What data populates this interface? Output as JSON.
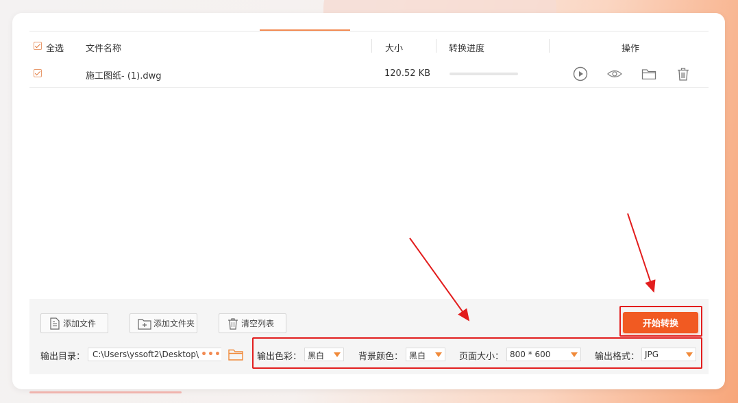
{
  "table": {
    "headers": {
      "select_all": "全选",
      "file_name": "文件名称",
      "size": "大小",
      "progress": "转换进度",
      "actions": "操作"
    },
    "rows": [
      {
        "name": "施工图纸- (1).dwg",
        "size": "120.52 KB",
        "progress": 0,
        "checked": true
      }
    ]
  },
  "toolbar": {
    "add_file": "添加文件",
    "add_folder": "添加文件夹",
    "clear_list": "清空列表",
    "start": "开始转换"
  },
  "output": {
    "dir_label": "输出目录：",
    "dir_value": "C:\\Users\\yssoft2\\Desktop\\",
    "browse": "•••"
  },
  "settings": {
    "color_label": "输出色彩：",
    "color_value": "黑白",
    "bg_label": "背景颜色：",
    "bg_value": "黑白",
    "page_label": "页面大小：",
    "page_value": "800 * 600",
    "format_label": "输出格式：",
    "format_value": "JPG"
  },
  "colors": {
    "accent": "#f28a52",
    "start_button": "#f15a22",
    "highlight": "#e21d1d"
  },
  "icons": [
    "check-icon",
    "play-icon",
    "eye-icon",
    "folder-icon",
    "trash-icon",
    "add-file-icon",
    "add-folder-icon",
    "clear-list-icon",
    "chevron-down-icon"
  ]
}
